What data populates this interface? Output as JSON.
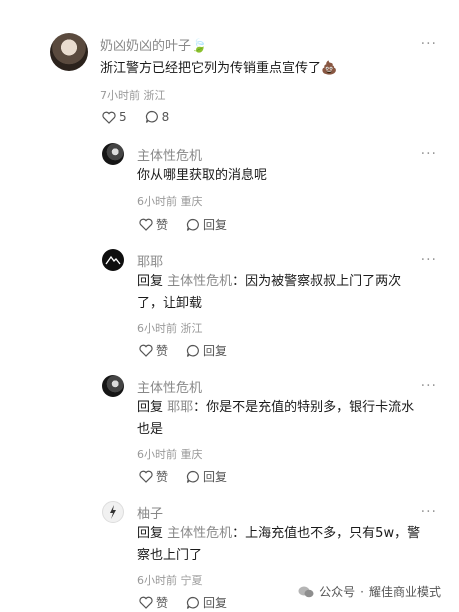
{
  "comments": [
    {
      "name": "奶凶奶凶的叶子",
      "name_emoji": "🍃",
      "text": "浙江警方已经把它列为传销重点宣传了",
      "text_emoji": "💩",
      "time": "7小时前",
      "location": "浙江",
      "likes": "5",
      "replies": "8"
    },
    {
      "name": "主体性危机",
      "text": "你从哪里获取的消息呢",
      "time": "6小时前",
      "location": "重庆",
      "like_label": "赞",
      "reply_label": "回复"
    },
    {
      "name": "耶耶",
      "reply_prefix": "回复",
      "reply_target": "主体性危机",
      "text_line1": "：因为被警察叔叔上门了两次",
      "text_line2": "了，让卸载",
      "time": "6小时前",
      "location": "浙江",
      "like_label": "赞",
      "reply_label": "回复"
    },
    {
      "name": "主体性危机",
      "reply_prefix": "回复",
      "reply_target": "耶耶",
      "text_line1": "：你是不是充值的特别多，银行卡流水",
      "text_line2": "也是",
      "time": "6小时前",
      "location": "重庆",
      "like_label": "赞",
      "reply_label": "回复"
    },
    {
      "name": "柚子",
      "reply_prefix": "回复",
      "reply_target": "主体性危机",
      "text_line1": "：上海充值也不多，只有5w，警",
      "text_line2": "察也上门了",
      "time": "6小时前",
      "location": "宁夏",
      "like_label": "赞",
      "reply_label": "回复"
    }
  ],
  "more_label": "···",
  "watermark": {
    "source": "公众号",
    "separator": "·",
    "account": "耀佳商业模式"
  }
}
